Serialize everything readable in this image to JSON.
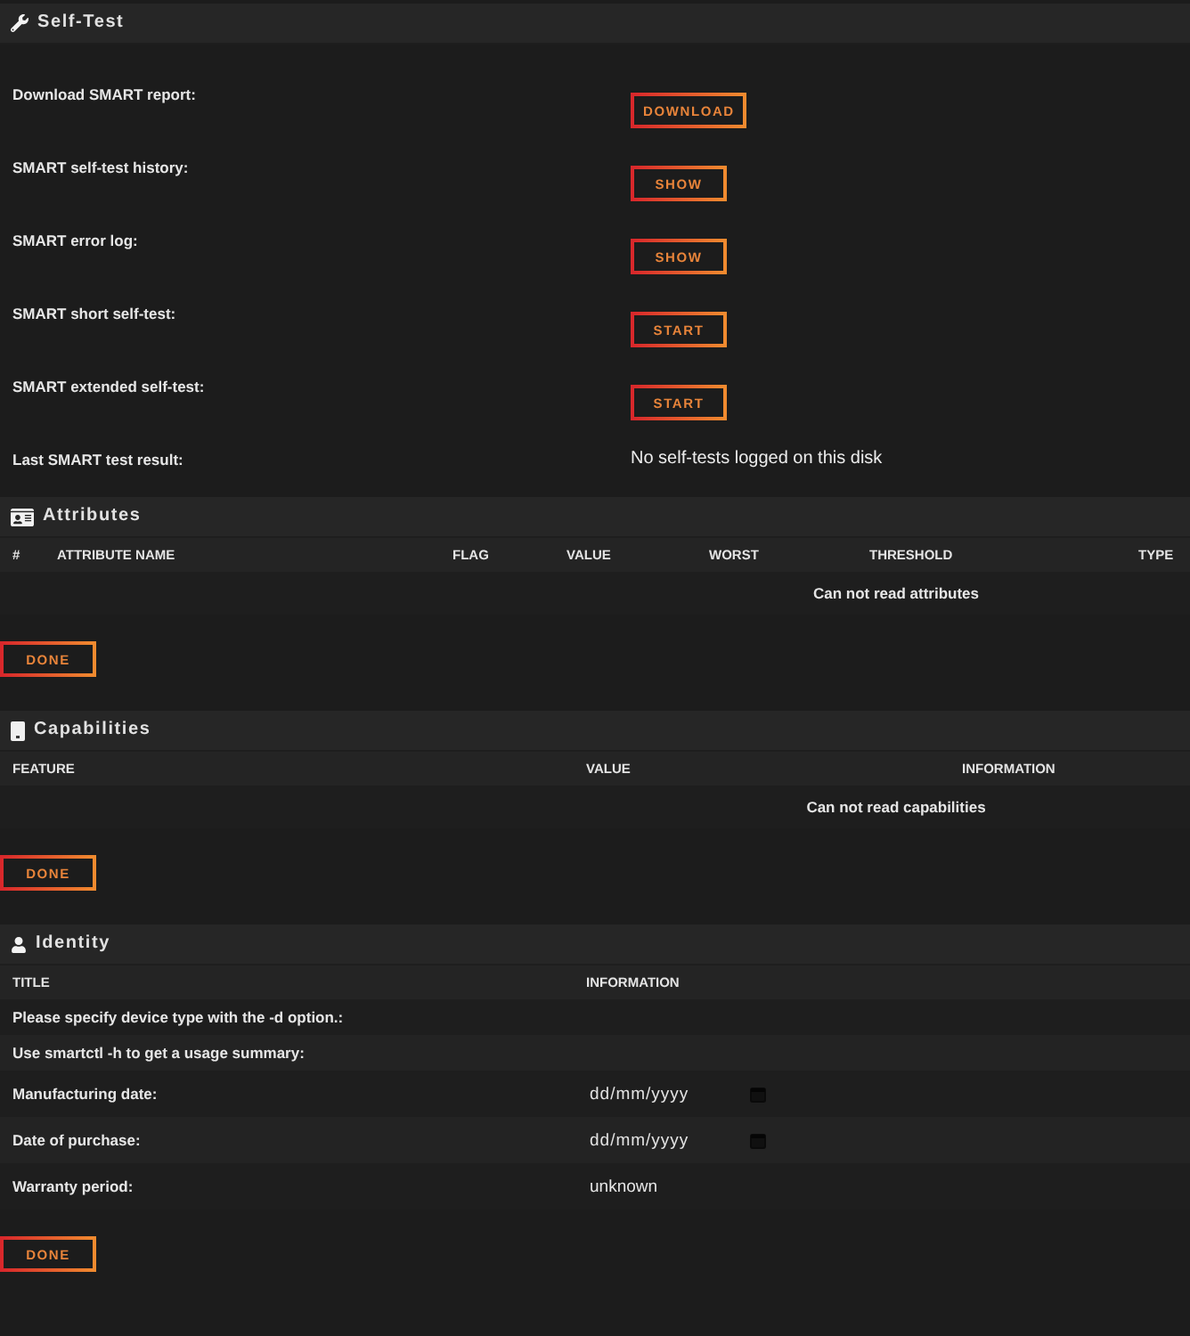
{
  "self_test": {
    "title": "Self-Test",
    "rows": [
      {
        "kind": "button",
        "label": "Download SMART report:",
        "button": "DOWNLOAD"
      },
      {
        "kind": "button",
        "label": "SMART self-test history:",
        "button": "SHOW"
      },
      {
        "kind": "button",
        "label": "SMART error log:",
        "button": "SHOW"
      },
      {
        "kind": "button",
        "label": "SMART short self-test:",
        "button": "START"
      },
      {
        "kind": "button",
        "label": "SMART extended self-test:",
        "button": "START"
      },
      {
        "kind": "result",
        "label": "Last SMART test result:",
        "value": "No self-tests logged on this disk"
      }
    ]
  },
  "attributes": {
    "title": "Attributes",
    "columns": [
      "#",
      "ATTRIBUTE NAME",
      "FLAG",
      "VALUE",
      "WORST",
      "THRESHOLD",
      "TYPE"
    ],
    "message": "Can not read attributes",
    "button": "DONE"
  },
  "capabilities": {
    "title": "Capabilities",
    "columns": [
      "FEATURE",
      "VALUE",
      "INFORMATION"
    ],
    "message": "Can not read capabilities",
    "button": "DONE"
  },
  "identity": {
    "title": "Identity",
    "columns": [
      "TITLE",
      "INFORMATION"
    ],
    "rows": [
      {
        "kind": "note",
        "title": "Please specify device type with the -d option.:"
      },
      {
        "kind": "note",
        "title": "Use smartctl -h to get a usage summary:"
      },
      {
        "kind": "date",
        "title": "Manufacturing date:",
        "placeholder": "dd/mm/yyyy"
      },
      {
        "kind": "date",
        "title": "Date of purchase:",
        "placeholder": "dd/mm/yyyy"
      },
      {
        "kind": "value",
        "title": "Warranty period:",
        "value": "unknown"
      }
    ],
    "button": "DONE"
  }
}
